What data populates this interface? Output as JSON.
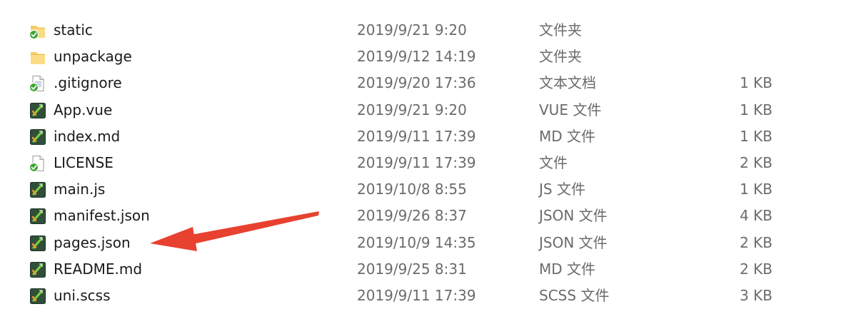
{
  "files": [
    {
      "name": "static",
      "date": "2019/9/21 9:20",
      "type": "文件夹",
      "size": "",
      "icon": "folder-synced-icon"
    },
    {
      "name": "unpackage",
      "date": "2019/9/12 14:19",
      "type": "文件夹",
      "size": "",
      "icon": "folder-icon"
    },
    {
      "name": ".gitignore",
      "date": "2019/9/20 17:36",
      "type": "文本文档",
      "size": "1 KB",
      "icon": "text-file-synced-icon"
    },
    {
      "name": "App.vue",
      "date": "2019/9/21 9:20",
      "type": "VUE 文件",
      "size": "1 KB",
      "icon": "editor-file-icon"
    },
    {
      "name": "index.md",
      "date": "2019/9/11 17:39",
      "type": "MD 文件",
      "size": "1 KB",
      "icon": "editor-file-icon"
    },
    {
      "name": "LICENSE",
      "date": "2019/9/11 17:39",
      "type": "文件",
      "size": "2 KB",
      "icon": "blank-file-synced-icon"
    },
    {
      "name": "main.js",
      "date": "2019/10/8 8:55",
      "type": "JS 文件",
      "size": "1 KB",
      "icon": "editor-file-icon"
    },
    {
      "name": "manifest.json",
      "date": "2019/9/26 8:37",
      "type": "JSON 文件",
      "size": "4 KB",
      "icon": "editor-file-icon"
    },
    {
      "name": "pages.json",
      "date": "2019/10/9 14:35",
      "type": "JSON 文件",
      "size": "2 KB",
      "icon": "editor-file-icon"
    },
    {
      "name": "README.md",
      "date": "2019/9/25 8:31",
      "type": "MD 文件",
      "size": "2 KB",
      "icon": "editor-file-icon"
    },
    {
      "name": "uni.scss",
      "date": "2019/9/11 17:39",
      "type": "SCSS 文件",
      "size": "3 KB",
      "icon": "editor-file-icon"
    }
  ],
  "annotation": {
    "color": "#e8412f",
    "points_to": "pages.json"
  }
}
